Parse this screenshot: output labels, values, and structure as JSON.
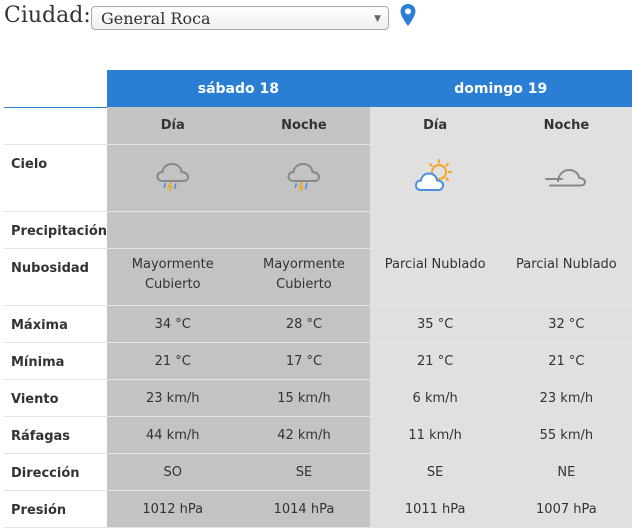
{
  "city_label": "Ciudad:",
  "city_select": {
    "value": "General Roca"
  },
  "days": [
    {
      "title": "sábado 18"
    },
    {
      "title": "domingo 19"
    }
  ],
  "periods": [
    "Día",
    "Noche",
    "Día",
    "Noche"
  ],
  "row_labels": {
    "cielo": "Cielo",
    "precipitacion": "Precipitación",
    "nubosidad": "Nubosidad",
    "maxima": "Máxima",
    "minima": "Mínima",
    "viento": "Viento",
    "rafagas": "Ráfagas",
    "direccion": "Dirección",
    "presion": "Presión"
  },
  "icons": [
    "storm-cloud-icon",
    "storm-cloud-icon",
    "partly-sunny-icon",
    "cloudy-night-icon"
  ],
  "precipitacion": [
    "",
    "",
    "",
    ""
  ],
  "nubosidad": [
    {
      "line1": "Mayormente",
      "line2": "Cubierto"
    },
    {
      "line1": "Mayormente",
      "line2": "Cubierto"
    },
    {
      "line1": "Parcial Nublado",
      "line2": ""
    },
    {
      "line1": "Parcial Nublado",
      "line2": ""
    }
  ],
  "maxima": [
    "34 °C",
    "28 °C",
    "35 °C",
    "32 °C"
  ],
  "minima": [
    "21 °C",
    "17 °C",
    "21 °C",
    "21 °C"
  ],
  "viento": [
    "23 km/h",
    "15 km/h",
    "6 km/h",
    "23 km/h"
  ],
  "rafagas": [
    "44 km/h",
    "42 km/h",
    "11 km/h",
    "55 km/h"
  ],
  "direccion": [
    "SO",
    "SE",
    "SE",
    "NE"
  ],
  "presion": [
    "1012 hPa",
    "1014 hPa",
    "1011 hPa",
    "1007 hPa"
  ],
  "colors": {
    "header_blue": "#2a7fd4",
    "day1_bg": "#c3c3c3",
    "day2_bg": "#e0e0e0",
    "sun": "#f5a623",
    "cloud_blue": "#4a90e2"
  }
}
